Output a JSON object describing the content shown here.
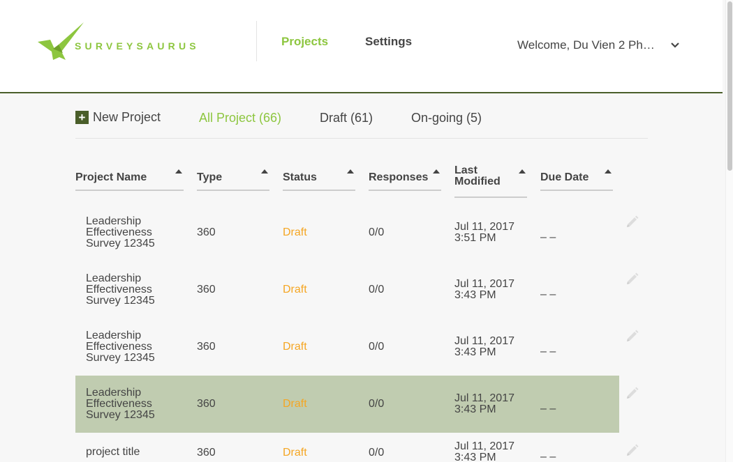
{
  "brand": {
    "name": "SURVEYSAURUS",
    "color": "#8dc63f"
  },
  "nav": {
    "projects": "Projects",
    "settings": "Settings"
  },
  "user": {
    "welcome": "Welcome, Du Vien 2 Ph…"
  },
  "actions": {
    "new_project": "New Project",
    "plus": "+"
  },
  "tabs": {
    "all": "All Project (66)",
    "draft": "Draft (61)",
    "ongoing": "On-going (5)"
  },
  "columns": {
    "name": "Project Name",
    "type": "Type",
    "status": "Status",
    "responses": "Responses",
    "modified_1": "Last",
    "modified_2": "Modified",
    "due": "Due Date"
  },
  "rows": [
    {
      "name1": "Leadership",
      "name2": "Effectiveness",
      "name3": "Survey 12345",
      "type": "360",
      "status": "Draft",
      "responses": "0/0",
      "mod1": "Jul 11, 2017",
      "mod2": "3:51 PM",
      "due": "– –"
    },
    {
      "name1": "Leadership",
      "name2": "Effectiveness",
      "name3": "Survey 12345",
      "type": "360",
      "status": "Draft",
      "responses": "0/0",
      "mod1": "Jul 11, 2017",
      "mod2": "3:43 PM",
      "due": "– –"
    },
    {
      "name1": "Leadership",
      "name2": "Effectiveness",
      "name3": "Survey 12345",
      "type": "360",
      "status": "Draft",
      "responses": "0/0",
      "mod1": "Jul 11, 2017",
      "mod2": "3:43 PM",
      "due": "– –"
    },
    {
      "name1": "Leadership",
      "name2": "Effectiveness",
      "name3": "Survey 12345",
      "type": "360",
      "status": "Draft",
      "responses": "0/0",
      "mod1": "Jul 11, 2017",
      "mod2": "3:43 PM",
      "due": "– –"
    },
    {
      "name1": "project title",
      "name2": "",
      "name3": "",
      "type": "360",
      "status": "Draft",
      "responses": "0/0",
      "mod1": "Jul 11, 2017",
      "mod2": "3:43 PM",
      "due": "– –"
    }
  ],
  "colors": {
    "accent": "#8dc63f",
    "dark_green": "#4a5e2a",
    "draft_status": "#f5a623",
    "selected_row": "#c0ccb0"
  }
}
